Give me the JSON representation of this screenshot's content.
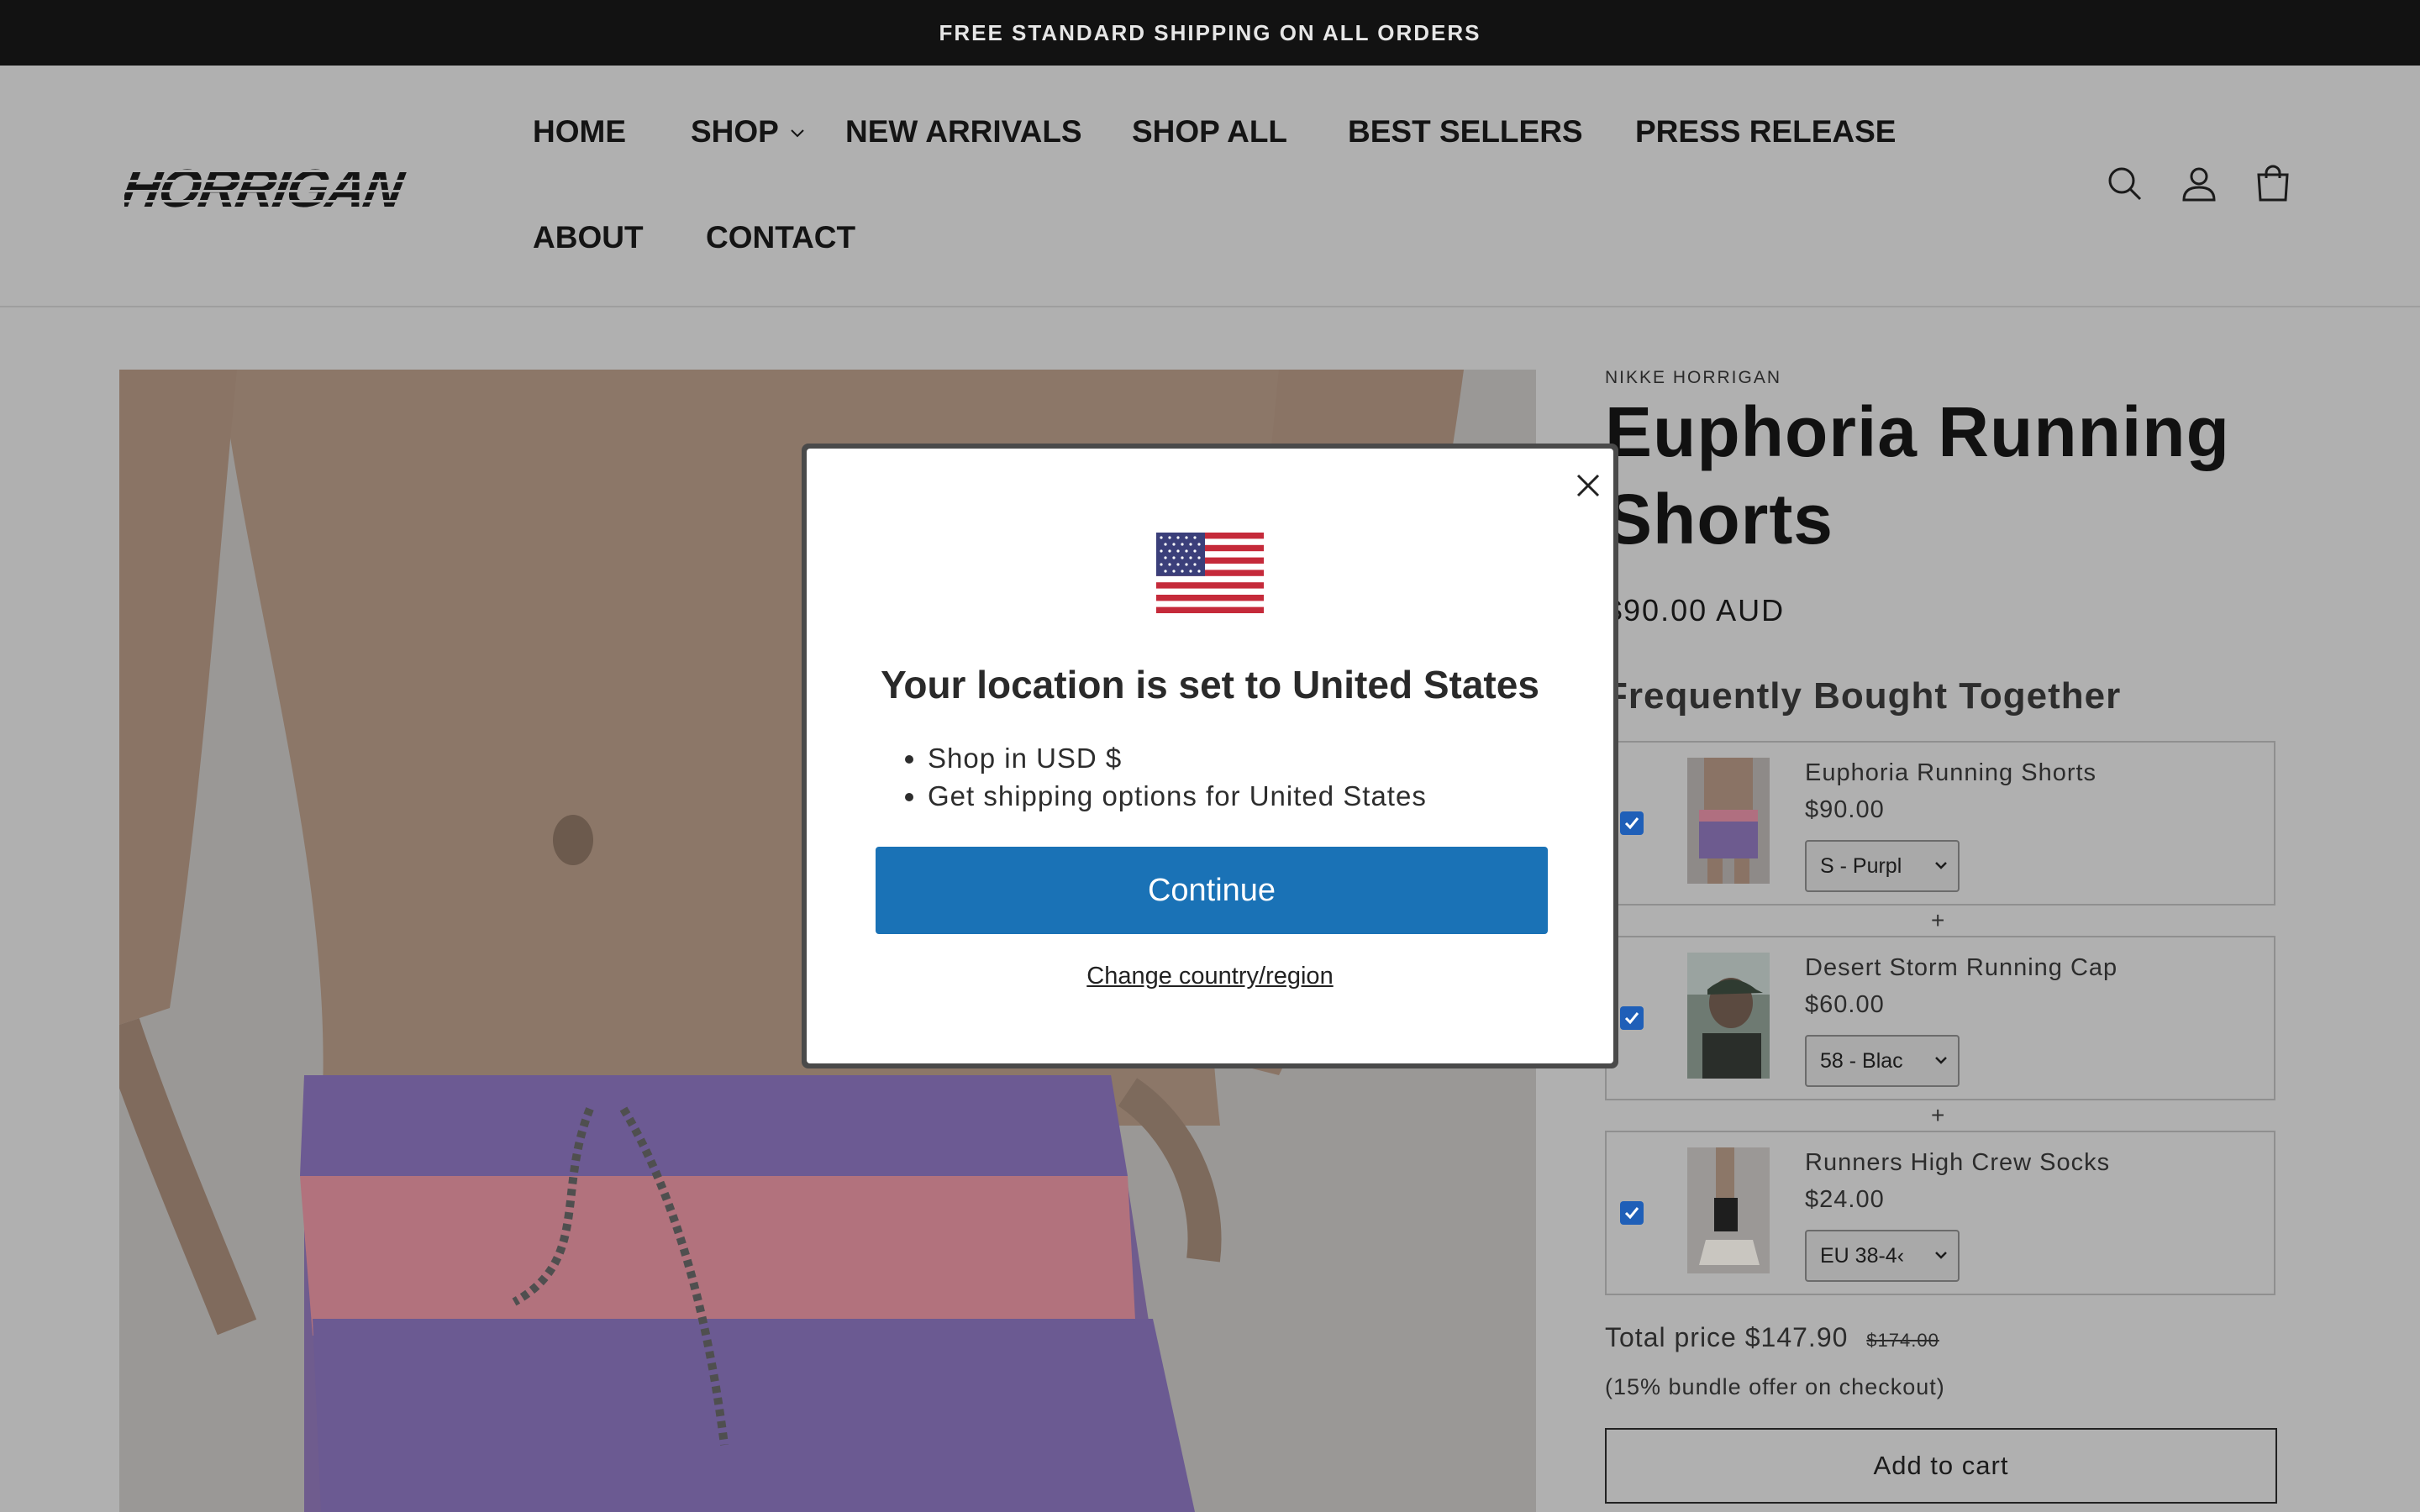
{
  "announcement": "FREE STANDARD SHIPPING ON ALL ORDERS",
  "header": {
    "logo": "HORRIGAN",
    "nav": [
      "HOME",
      "SHOP",
      "NEW ARRIVALS",
      "SHOP ALL",
      "BEST SELLERS",
      "PRESS RELEASE",
      "ABOUT",
      "CONTACT"
    ],
    "icons": [
      "search-icon",
      "account-icon",
      "cart-icon"
    ]
  },
  "product": {
    "vendor": "NIKKE HORRIGAN",
    "title_line1": "Euphoria Running",
    "title_line2": "Shorts",
    "price": "$90.00 AUD"
  },
  "bundle": {
    "heading": "Frequently Bought Together",
    "items": [
      {
        "name": "Euphoria Running Shorts",
        "price": "$90.00",
        "option": "S - Purpl",
        "checked": true
      },
      {
        "name": "Desert Storm Running Cap",
        "price": "$60.00",
        "option": "58 - Blac",
        "checked": true
      },
      {
        "name": "Runners High Crew Socks",
        "price": "$24.00",
        "option": "EU 38-4‹",
        "checked": true
      }
    ],
    "plus": "+",
    "total_label": "Total price",
    "total_price": "$147.90",
    "old_price": "$174.00",
    "note": "(15% bundle offer on checkout)",
    "add_to_cart": "Add to cart"
  },
  "modal": {
    "title": "Your location is set to United States",
    "bullets": [
      "Shop in USD $",
      "Get shipping options for United States"
    ],
    "continue": "Continue",
    "change": "Change country/region"
  },
  "colors": {
    "overlay": "#b0b0b0",
    "announcement_bg": "#121212",
    "primary_button": "#1a72b6",
    "checkbox": "#1f5fb8"
  }
}
